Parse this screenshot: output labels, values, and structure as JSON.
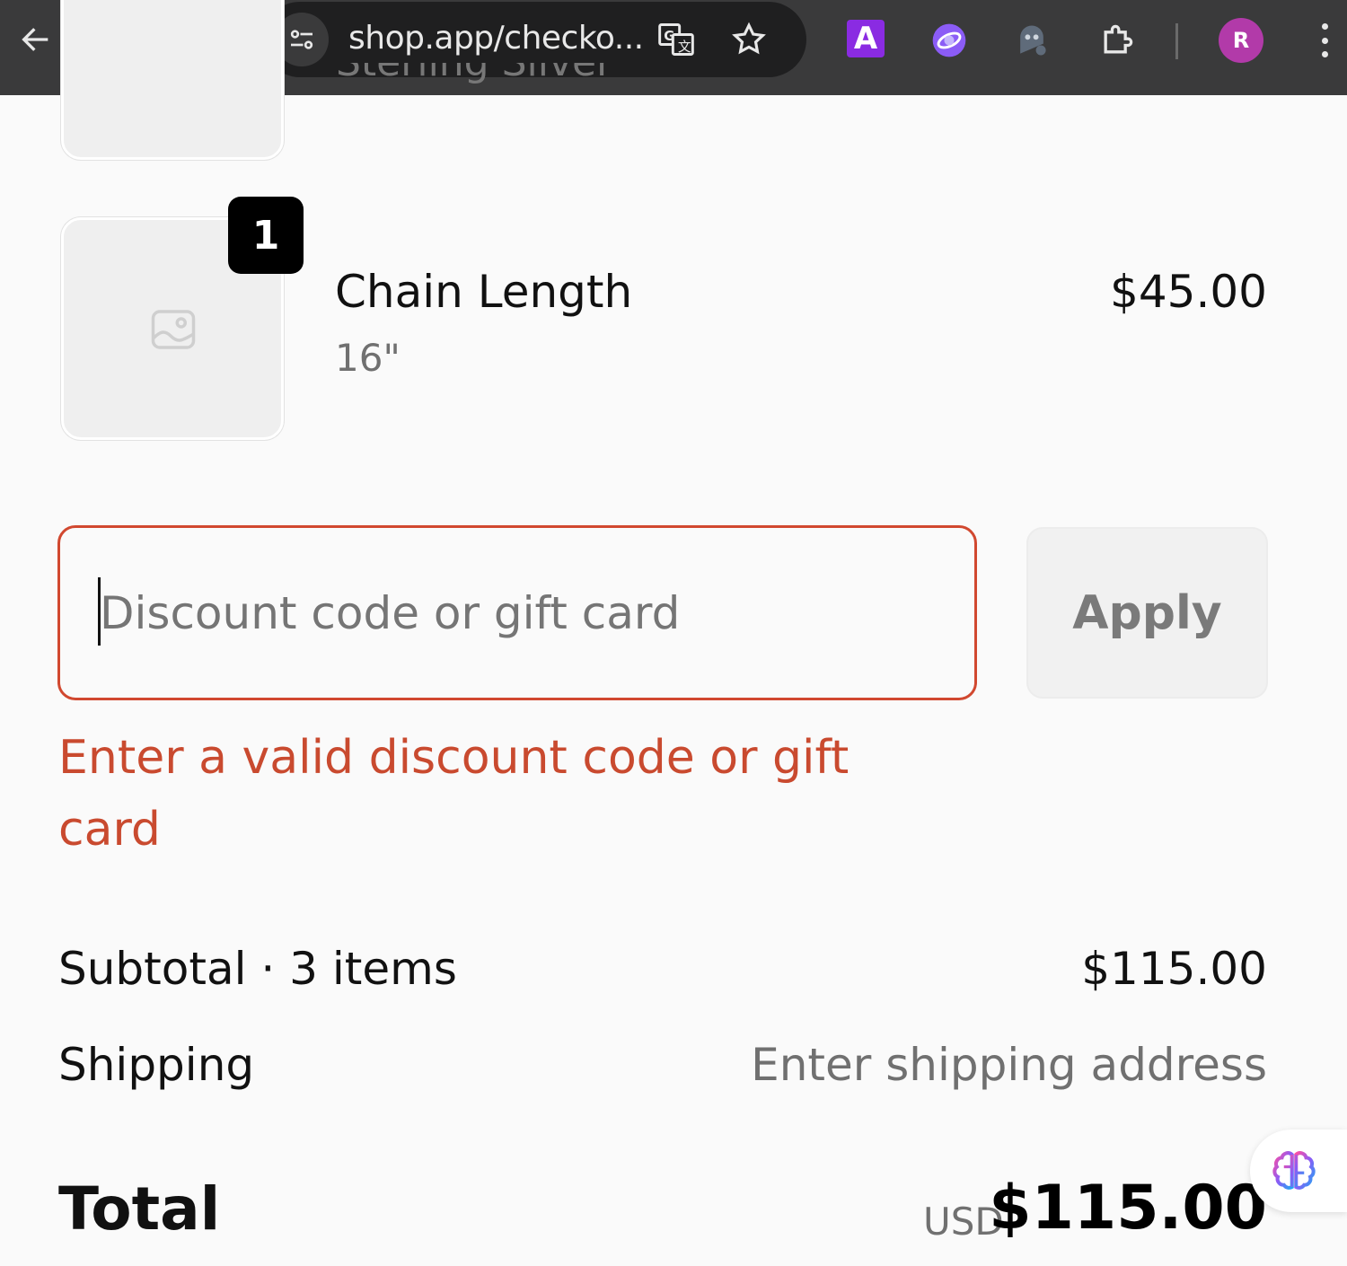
{
  "browser": {
    "url": "shop.app/checko...",
    "profile_initial": "R",
    "extension_a_label": "A"
  },
  "cart": {
    "hidden_item_name_fragment": "Sterling Silver",
    "item": {
      "quantity": "1",
      "name": "Chain Length",
      "variant": "16\"",
      "price": "$45.00"
    }
  },
  "discount": {
    "placeholder": "Discount code or gift card",
    "value": "",
    "apply_label": "Apply",
    "error": "Enter a valid discount code or gift card"
  },
  "summary": {
    "subtotal_label": "Subtotal · 3 items",
    "subtotal_value": "$115.00",
    "shipping_label": "Shipping",
    "shipping_value": "Enter shipping address",
    "total_label": "Total",
    "total_currency": "USD",
    "total_value": "$115.00"
  },
  "colors": {
    "error": "#c94a2f",
    "toolbar": "#3a3a3b",
    "avatar": "#b23aa9"
  }
}
